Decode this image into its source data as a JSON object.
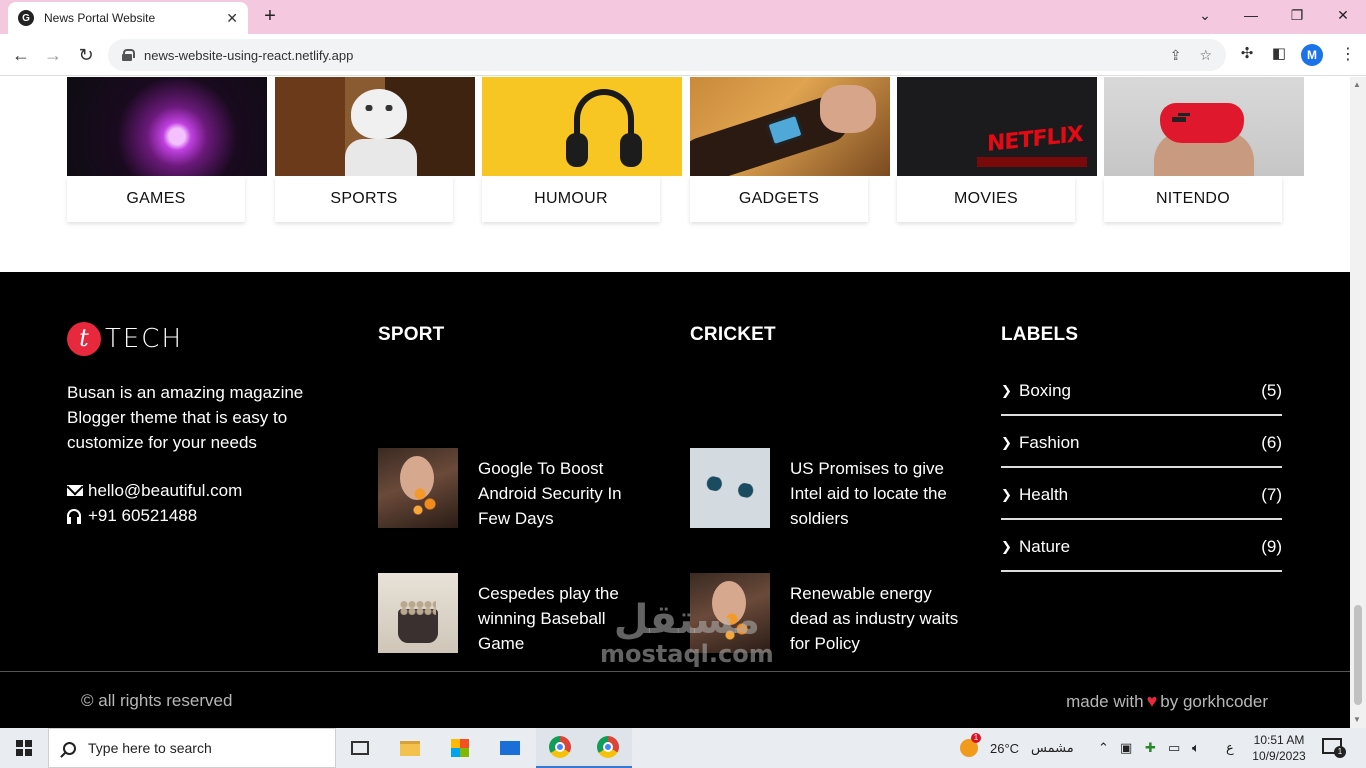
{
  "browser": {
    "tab_title": "News Portal Website",
    "tab_close": "✕",
    "new_tab": "+",
    "url": "news-website-using-react.netlify.app",
    "profile_initial": "M",
    "window_controls": {
      "dropdown": "⌄",
      "minimize": "—",
      "restore": "❐",
      "close": "✕"
    }
  },
  "categories": [
    {
      "label": "GAMES"
    },
    {
      "label": "SPORTS"
    },
    {
      "label": "HUMOUR"
    },
    {
      "label": "GADGETS"
    },
    {
      "label": "MOVIES"
    },
    {
      "label": "NITENDO"
    }
  ],
  "footer": {
    "logo_badge": "t",
    "logo_text": "TECH",
    "about": "Busan is an amazing magazine Blogger theme that is easy to customize for your needs",
    "email": "hello@beautiful.com",
    "phone": "+91 60521488",
    "sport": {
      "title": "SPORT",
      "posts": [
        {
          "title": "Google To Boost Android Security In Few Days"
        },
        {
          "title": "Cespedes play the winning Baseball Game"
        }
      ]
    },
    "cricket": {
      "title": "CRICKET",
      "posts": [
        {
          "title": "US Promises to give Intel aid to locate the soldiers"
        },
        {
          "title": "Renewable energy dead as industry waits for Policy"
        }
      ]
    },
    "labels": {
      "title": "LABELS",
      "items": [
        {
          "name": "Boxing",
          "count": "(5)"
        },
        {
          "name": "Fashion",
          "count": "(6)"
        },
        {
          "name": "Health",
          "count": "(7)"
        },
        {
          "name": "Nature",
          "count": "(9)"
        }
      ]
    },
    "copyright": "© all rights reserved",
    "made_with_prefix": "made with",
    "made_with_suffix": "by gorkhcoder",
    "heart": "♥"
  },
  "watermark": {
    "arabic": "مستقل",
    "latin": "mostaql.com"
  },
  "taskbar": {
    "search_placeholder": "Type here to search",
    "temperature": "26°C",
    "weather_condition": "مشمس",
    "language": "ع",
    "time": "10:51 AM",
    "date": "10/9/2023"
  },
  "colors": {
    "accent": "#e8283c",
    "footer_bg": "#000000",
    "tab_bar": "#f4c9df"
  }
}
